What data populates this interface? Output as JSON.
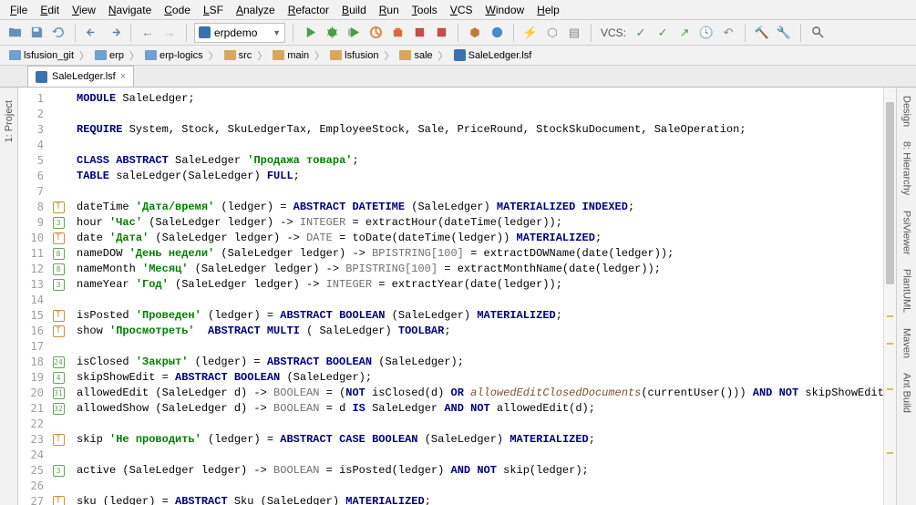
{
  "menu": [
    "File",
    "Edit",
    "View",
    "Navigate",
    "Code",
    "LSF",
    "Analyze",
    "Refactor",
    "Build",
    "Run",
    "Tools",
    "VCS",
    "Window",
    "Help"
  ],
  "runconfig": "erpdemo",
  "vcs_label": "VCS:",
  "breadcrumb": [
    {
      "label": "lsfusion_git",
      "cls": "blue"
    },
    {
      "label": "erp",
      "cls": "blue"
    },
    {
      "label": "erp-logics",
      "cls": "blue"
    },
    {
      "label": "src",
      "cls": ""
    },
    {
      "label": "main",
      "cls": ""
    },
    {
      "label": "lsfusion",
      "cls": ""
    },
    {
      "label": "sale",
      "cls": ""
    },
    {
      "label": "SaleLedger.lsf",
      "cls": "file"
    }
  ],
  "tab": {
    "label": "SaleLedger.lsf"
  },
  "left_tool": "1: Project",
  "right_tools": [
    "Design",
    "8: Hierarchy",
    "PsiViewer",
    "PlantUML",
    "Maven",
    "Ant Build"
  ],
  "lines": [
    {
      "n": 1,
      "m": "",
      "html": "<span class='kw'>MODULE</span> SaleLedger;"
    },
    {
      "n": 2,
      "m": "",
      "html": ""
    },
    {
      "n": 3,
      "m": "",
      "html": "<span class='kw'>REQUIRE</span> System, Stock, SkuLedgerTax, EmployeeStock, Sale, PriceRound, StockSkuDocument, SaleOperation;"
    },
    {
      "n": 4,
      "m": "",
      "html": ""
    },
    {
      "n": 5,
      "m": "",
      "html": "<span class='kw'>CLASS</span> <span class='kw'>ABSTRACT</span> SaleLedger <span class='str'>'Продажа товара'</span>;"
    },
    {
      "n": 6,
      "m": "",
      "html": "<span class='kw'>TABLE</span> saleLedger(SaleLedger) <span class='kw'>FULL</span>;"
    },
    {
      "n": 7,
      "m": "",
      "html": ""
    },
    {
      "n": 8,
      "m": "T",
      "html": "dateTime <span class='str'>'Дата/время'</span> (ledger) = <span class='kw'>ABSTRACT</span> <span class='kw'>DATETIME</span> (SaleLedger) <span class='kw'>MATERIALIZED</span> <span class='kw'>INDEXED</span>;"
    },
    {
      "n": 9,
      "m": "3",
      "html": "hour <span class='str'>'Час'</span> (SaleLedger ledger) -&gt; <span class='type'>INTEGER</span> = extractHour(dateTime(ledger));"
    },
    {
      "n": 10,
      "m": "T",
      "html": "date <span class='str'>'Дата'</span> (SaleLedger ledger) -&gt; <span class='type'>DATE</span> = toDate(dateTime(ledger)) <span class='kw'>MATERIALIZED</span>;"
    },
    {
      "n": 11,
      "m": "8",
      "html": "nameDOW <span class='str'>'День недели'</span> (SaleLedger ledger) -&gt; <span class='type'>BPISTRING[100]</span> = extractDOWName(date(ledger));"
    },
    {
      "n": 12,
      "m": "8",
      "html": "nameMonth <span class='str'>'Месяц'</span> (SaleLedger ledger) -&gt; <span class='type'>BPISTRING[100]</span> = extractMonthName(date(ledger));"
    },
    {
      "n": 13,
      "m": "3",
      "html": "nameYear <span class='str'>'Год'</span> (SaleLedger ledger) -&gt; <span class='type'>INTEGER</span> = extractYear(date(ledger));"
    },
    {
      "n": 14,
      "m": "",
      "html": ""
    },
    {
      "n": 15,
      "m": "T",
      "html": "isPosted <span class='str'>'Проведен'</span> (ledger) = <span class='kw'>ABSTRACT</span> <span class='kw'>BOOLEAN</span> (SaleLedger) <span class='kw'>MATERIALIZED</span>;"
    },
    {
      "n": 16,
      "m": "T",
      "html": "show <span class='str'>'Просмотреть'</span>  <span class='kw'>ABSTRACT</span> <span class='kw'>MULTI</span> ( SaleLedger) <span class='kw'>TOOLBAR</span>;"
    },
    {
      "n": 17,
      "m": "",
      "html": ""
    },
    {
      "n": 18,
      "m": "24",
      "html": "isClosed <span class='str'>'Закрыт'</span> (ledger) = <span class='kw'>ABSTRACT</span> <span class='kw'>BOOLEAN</span> (SaleLedger);"
    },
    {
      "n": 19,
      "m": "4",
      "html": "skipShowEdit = <span class='kw'>ABSTRACT</span> <span class='kw'>BOOLEAN</span> (SaleLedger);"
    },
    {
      "n": 20,
      "m": "31",
      "html": "allowedEdit (SaleLedger d) -&gt; <span class='type'>BOOLEAN</span> = (<span class='kw'>NOT</span> isClosed(d) <span class='kw'>OR</span> <span class='fn'>allowedEditClosedDocuments</span>(currentUser())) <span class='kw'>AND</span> <span class='kw'>NOT</span> skipShowEdit(d);"
    },
    {
      "n": 21,
      "m": "32",
      "html": "allowedShow (SaleLedger d) -&gt; <span class='type'>BOOLEAN</span> = d <span class='kw'>IS</span> SaleLedger <span class='kw'>AND</span> <span class='kw'>NOT</span> allowedEdit(d);"
    },
    {
      "n": 22,
      "m": "",
      "html": ""
    },
    {
      "n": 23,
      "m": "T",
      "html": "skip <span class='str'>'Не проводить'</span> (ledger) = <span class='kw'>ABSTRACT</span> <span class='kw'>CASE</span> <span class='kw'>BOOLEAN</span> (SaleLedger) <span class='kw'>MATERIALIZED</span>;"
    },
    {
      "n": 24,
      "m": "",
      "html": ""
    },
    {
      "n": 25,
      "m": "3",
      "html": "active (SaleLedger ledger) -&gt; <span class='type'>BOOLEAN</span> = isPosted(ledger) <span class='kw'>AND</span> <span class='kw'>NOT</span> skip(ledger);"
    },
    {
      "n": 26,
      "m": "",
      "html": ""
    },
    {
      "n": 27,
      "m": "T",
      "html": "sku (ledger) = <span class='kw'>ABSTRACT</span> Sku (SaleLedger) <span class='kw'>MATERIALIZED</span>;"
    }
  ]
}
